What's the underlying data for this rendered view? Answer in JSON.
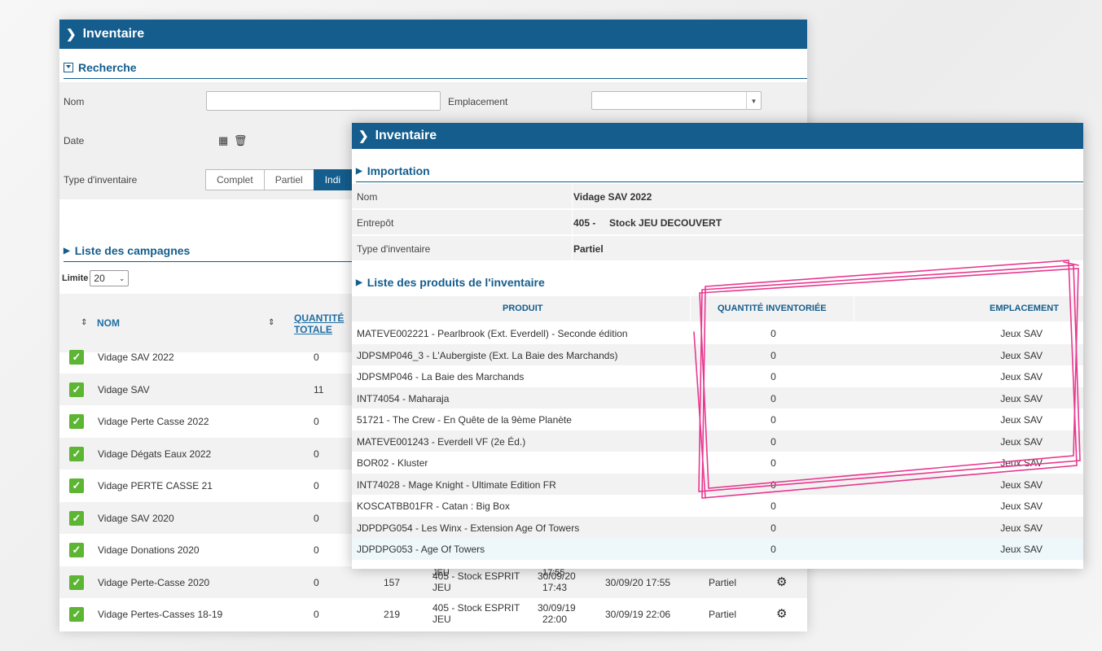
{
  "back": {
    "title": "Inventaire",
    "search": {
      "title": "Recherche",
      "nom_label": "Nom",
      "emplacement_label": "Emplacement",
      "date_label": "Date",
      "type_label": "Type d'inventaire",
      "types": [
        "Complet",
        "Partiel",
        "Indi"
      ]
    },
    "campagnes": {
      "title": "Liste des campagnes",
      "limit_label": "Limite",
      "limit_value": "20",
      "col_nom": "NOM",
      "col_qte_1": "QUANTITÉ",
      "col_qte_2": "TOTALE",
      "rows": [
        {
          "nom": "Vidage SAV 2022",
          "qte": "0"
        },
        {
          "nom": "Vidage SAV",
          "qte": "11"
        },
        {
          "nom": "Vidage Perte Casse 2022",
          "qte": "0"
        },
        {
          "nom": "Vidage Dégats Eaux 2022",
          "qte": "0"
        },
        {
          "nom": "Vidage PERTE CASSE 21",
          "qte": "0"
        },
        {
          "nom": "Vidage SAV 2020",
          "qte": "0"
        },
        {
          "nom": "Vidage Donations 2020",
          "qte": "0"
        },
        {
          "nom": "Vidage Perte-Casse 2020",
          "qte": "0",
          "n": "157",
          "stock": "405 - Stock ESPRIT",
          "stock2": "JEU",
          "date1": "30/09/20",
          "date1b": "17:43",
          "date2": "30/09/20 17:55",
          "type": "Partiel"
        },
        {
          "nom": "Vidage Pertes-Casses 18-19",
          "qte": "0",
          "n": "219",
          "stock": "405 - Stock ESPRIT",
          "stock2": "JEU",
          "date1": "30/09/19",
          "date1b": "22:00",
          "date2": "30/09/19 22:06",
          "type": "Partiel"
        }
      ],
      "peek_above": "JEU",
      "peek_above2": "17:55"
    }
  },
  "front": {
    "title": "Inventaire",
    "importation": {
      "title": "Importation",
      "nom_label": "Nom",
      "nom_value": "Vidage SAV 2022",
      "entrepot_label": "Entrepôt",
      "entrepot_value": "405 -     Stock JEU DECOUVERT",
      "type_label": "Type d'inventaire",
      "type_value": "Partiel"
    },
    "produits": {
      "title": "Liste des produits de l'inventaire",
      "col_produit": "PRODUIT",
      "col_qte": "QUANTITÉ INVENTORIÉE",
      "col_emplacement": "EMPLACEMENT",
      "rows": [
        {
          "produit": "MATEVE002221 - Pearlbrook (Ext. Everdell) - Seconde édition",
          "qte": "0",
          "emplacement": "Jeux SAV"
        },
        {
          "produit": "JDPSMP046_3 - L'Aubergiste (Ext. La Baie des Marchands)",
          "qte": "0",
          "emplacement": "Jeux SAV"
        },
        {
          "produit": "JDPSMP046 - La Baie des Marchands",
          "qte": "0",
          "emplacement": "Jeux SAV"
        },
        {
          "produit": "INT74054 - Maharaja",
          "qte": "0",
          "emplacement": "Jeux SAV"
        },
        {
          "produit": "51721 - The Crew - En Quête de la 9ème Planète",
          "qte": "0",
          "emplacement": "Jeux SAV"
        },
        {
          "produit": "MATEVE001243 - Everdell VF (2e Éd.)",
          "qte": "0",
          "emplacement": "Jeux SAV"
        },
        {
          "produit": "BOR02 - Kluster",
          "qte": "0",
          "emplacement": "Jeux SAV"
        },
        {
          "produit": "INT74028 - Mage Knight - Ultimate Edition FR",
          "qte": "0",
          "emplacement": "Jeux SAV"
        },
        {
          "produit": "KOSCATBB01FR - Catan : Big Box",
          "qte": "0",
          "emplacement": "Jeux SAV"
        },
        {
          "produit": "JDPDPG054 - Les Winx - Extension Age Of Towers",
          "qte": "0",
          "emplacement": "Jeux SAV"
        },
        {
          "produit": "JDPDPG053 - Age Of Towers",
          "qte": "0",
          "emplacement": "Jeux SAV"
        }
      ]
    }
  },
  "colors": {
    "header": "#145d8d",
    "check": "#5cb533",
    "highlight": "#e8388f"
  }
}
